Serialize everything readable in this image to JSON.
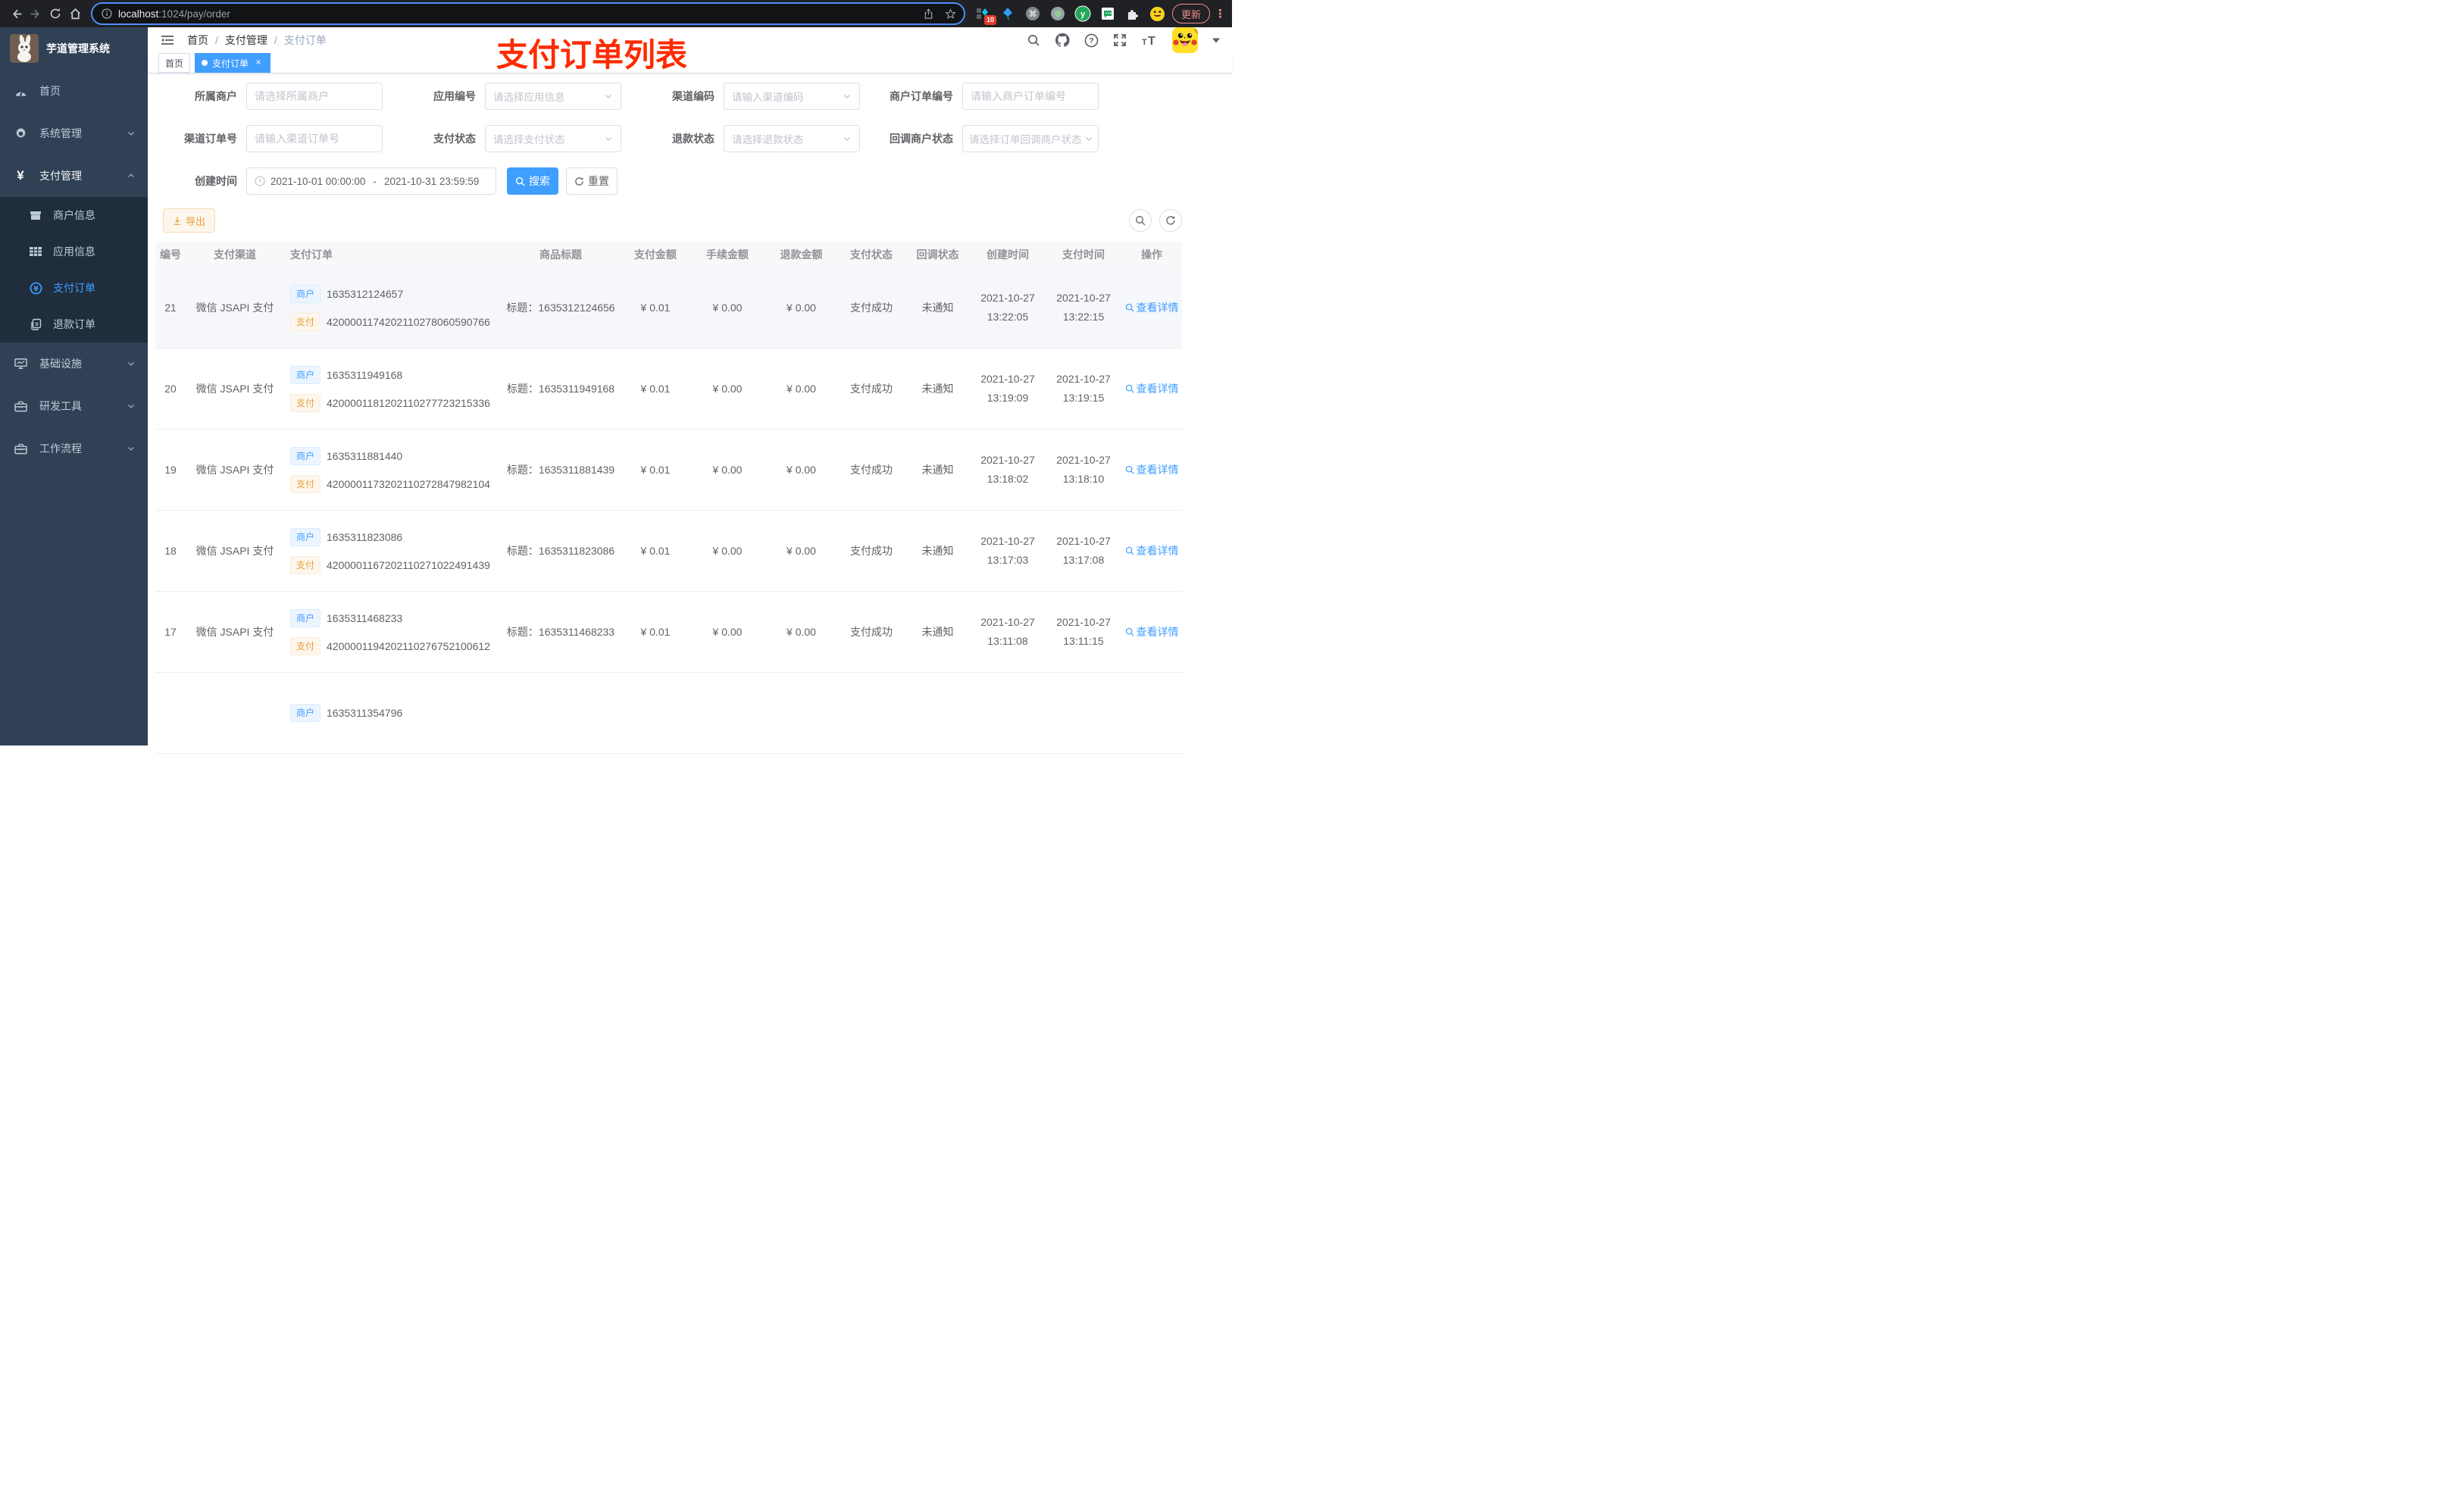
{
  "browser": {
    "url_host": "localhost",
    "url_rest": ":1024/pay/order",
    "ext_badge": "10",
    "update_label": "更新"
  },
  "app_title": "芋道管理系统",
  "sidebar": {
    "home": "首页",
    "system": "系统管理",
    "pay": "支付管理",
    "sub_merchant": "商户信息",
    "sub_app": "应用信息",
    "sub_order": "支付订单",
    "sub_refund": "退款订单",
    "infra": "基础设施",
    "devtools": "研发工具",
    "workflow": "工作流程"
  },
  "header": {
    "breadcrumb": [
      "首页",
      "支付管理",
      "支付订单"
    ],
    "sep": "/",
    "annotation": "支付订单列表"
  },
  "tags": {
    "home": "首页",
    "current": "支付订单",
    "close": "×"
  },
  "filters": {
    "merchant": {
      "label": "所属商户",
      "placeholder": "请选择所属商户"
    },
    "app_no": {
      "label": "应用编号",
      "placeholder": "请选择应用信息"
    },
    "channel_code": {
      "label": "渠道编码",
      "placeholder": "请输入渠道编码"
    },
    "merchant_order_no": {
      "label": "商户订单编号",
      "placeholder": "请输入商户订单编号"
    },
    "channel_order_no": {
      "label": "渠道订单号",
      "placeholder": "请输入渠道订单号"
    },
    "pay_status": {
      "label": "支付状态",
      "placeholder": "请选择支付状态"
    },
    "refund_status": {
      "label": "退款状态",
      "placeholder": "请选择退款状态"
    },
    "notify_status": {
      "label": "回调商户状态",
      "placeholder": "请选择订单回调商户状态"
    },
    "create_time": {
      "label": "创建时间",
      "from": "2021-10-01 00:00:00",
      "dash": "-",
      "to": "2021-10-31 23:59:59"
    },
    "search": "搜索",
    "reset": "重置"
  },
  "toolbar": {
    "export": "导出"
  },
  "table": {
    "tag_merchant": "商户",
    "tag_pay": "支付",
    "action": "查看详情",
    "headers": [
      "编号",
      "支付渠道",
      "支付订单",
      "商品标题",
      "支付金额",
      "手续金额",
      "退款金额",
      "支付状态",
      "回调状态",
      "创建时间",
      "支付时间",
      "操作"
    ],
    "rows": [
      {
        "id": "21",
        "channel": "微信 JSAPI 支付",
        "merchant_no": "1635312124657",
        "pay_no": "4200001174202110278060590766",
        "title": "标题：1635312124656",
        "amount": "¥ 0.01",
        "fee": "¥ 0.00",
        "refund": "¥ 0.00",
        "status": "支付成功",
        "notify": "未通知",
        "created_date": "2021-10-27",
        "created_time": "13:22:05",
        "paid_date": "2021-10-27",
        "paid_time": "13:22:15"
      },
      {
        "id": "20",
        "channel": "微信 JSAPI 支付",
        "merchant_no": "1635311949168",
        "pay_no": "4200001181202110277723215336",
        "title": "标题：1635311949168",
        "amount": "¥ 0.01",
        "fee": "¥ 0.00",
        "refund": "¥ 0.00",
        "status": "支付成功",
        "notify": "未通知",
        "created_date": "2021-10-27",
        "created_time": "13:19:09",
        "paid_date": "2021-10-27",
        "paid_time": "13:19:15"
      },
      {
        "id": "19",
        "channel": "微信 JSAPI 支付",
        "merchant_no": "1635311881440",
        "pay_no": "4200001173202110272847982104",
        "title": "标题：1635311881439",
        "amount": "¥ 0.01",
        "fee": "¥ 0.00",
        "refund": "¥ 0.00",
        "status": "支付成功",
        "notify": "未通知",
        "created_date": "2021-10-27",
        "created_time": "13:18:02",
        "paid_date": "2021-10-27",
        "paid_time": "13:18:10"
      },
      {
        "id": "18",
        "channel": "微信 JSAPI 支付",
        "merchant_no": "1635311823086",
        "pay_no": "4200001167202110271022491439",
        "title": "标题：1635311823086",
        "amount": "¥ 0.01",
        "fee": "¥ 0.00",
        "refund": "¥ 0.00",
        "status": "支付成功",
        "notify": "未通知",
        "created_date": "2021-10-27",
        "created_time": "13:17:03",
        "paid_date": "2021-10-27",
        "paid_time": "13:17:08"
      },
      {
        "id": "17",
        "channel": "微信 JSAPI 支付",
        "merchant_no": "1635311468233",
        "pay_no": "4200001194202110276752100612",
        "title": "标题：1635311468233",
        "amount": "¥ 0.01",
        "fee": "¥ 0.00",
        "refund": "¥ 0.00",
        "status": "支付成功",
        "notify": "未通知",
        "created_date": "2021-10-27",
        "created_time": "13:11:08",
        "paid_date": "2021-10-27",
        "paid_time": "13:11:15"
      },
      {
        "merchant_no": "1635311354796"
      }
    ]
  }
}
